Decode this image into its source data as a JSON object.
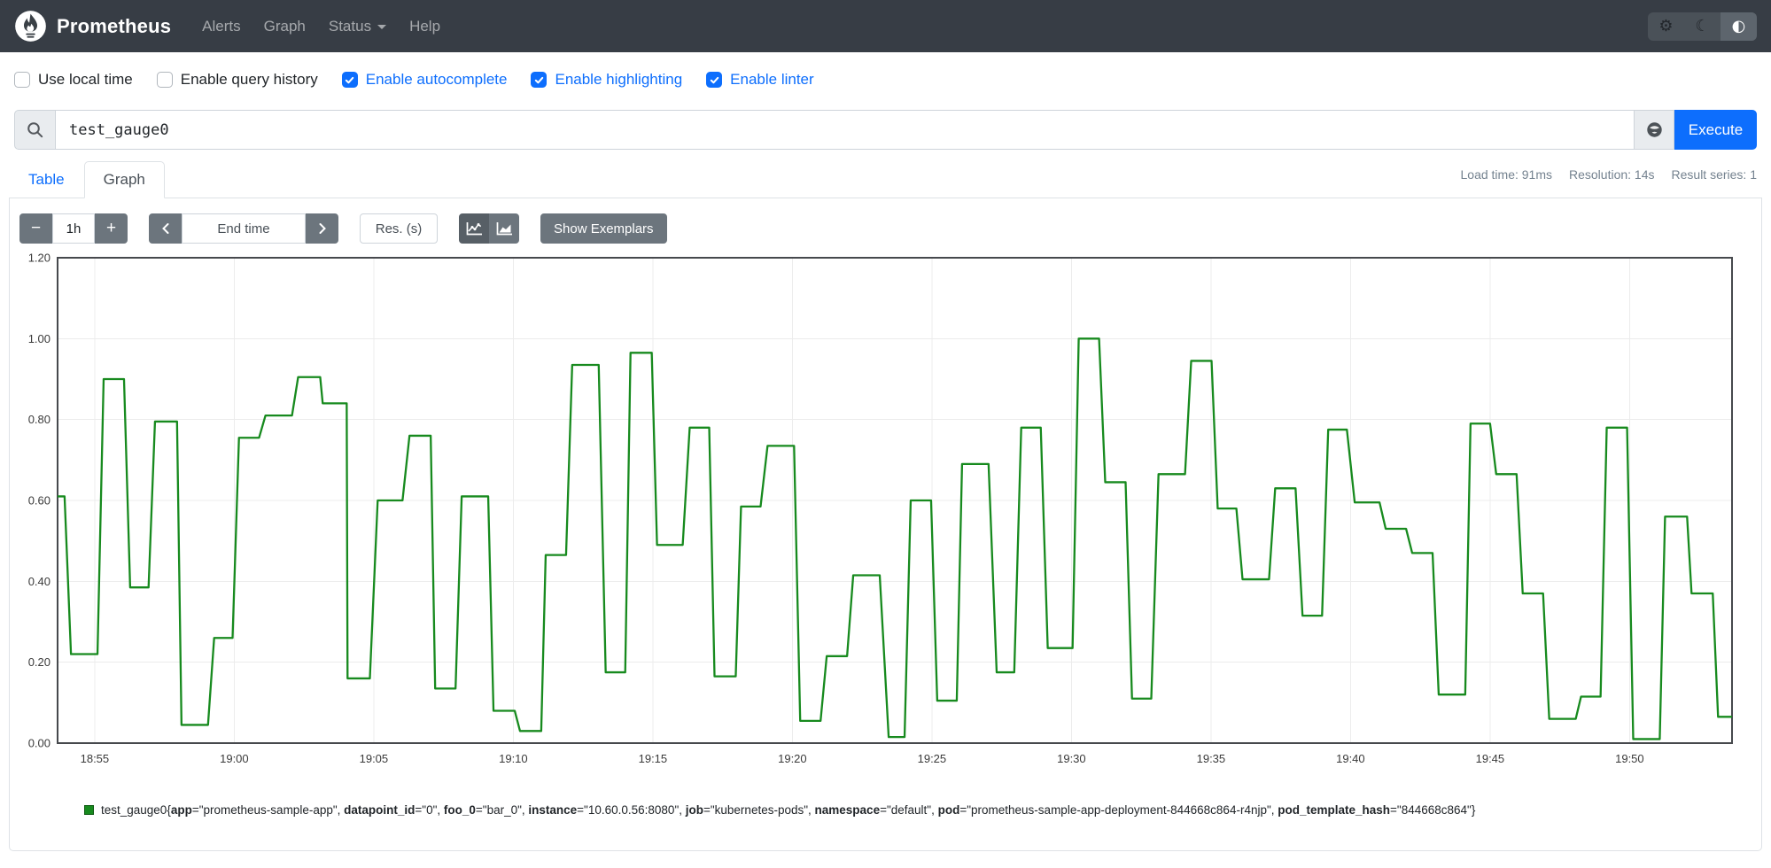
{
  "navbar": {
    "brand": "Prometheus",
    "items": [
      {
        "label": "Alerts",
        "has_caret": false
      },
      {
        "label": "Graph",
        "has_caret": false
      },
      {
        "label": "Status",
        "has_caret": true
      },
      {
        "label": "Help",
        "has_caret": false
      }
    ],
    "theme_buttons": [
      {
        "name": "settings",
        "icon": "gear-icon",
        "glyph": "⚙",
        "active": false
      },
      {
        "name": "dark-theme",
        "icon": "moon-icon",
        "glyph": "☾",
        "active": false
      },
      {
        "name": "auto-theme",
        "icon": "contrast-half-circle-icon",
        "glyph": "◐",
        "active": true
      }
    ]
  },
  "options": [
    {
      "label": "Use local time",
      "checked": false
    },
    {
      "label": "Enable query history",
      "checked": false
    },
    {
      "label": "Enable autocomplete",
      "checked": true
    },
    {
      "label": "Enable highlighting",
      "checked": true
    },
    {
      "label": "Enable linter",
      "checked": true
    }
  ],
  "query": {
    "value": "test_gauge0",
    "execute_label": "Execute",
    "search_icon": "magnifier",
    "explorer_icon": "globe"
  },
  "tabs": [
    {
      "label": "Table",
      "active": false
    },
    {
      "label": "Graph",
      "active": true
    }
  ],
  "stats": [
    {
      "label": "Load time",
      "value": "91ms"
    },
    {
      "label": "Resolution",
      "value": "14s"
    },
    {
      "label": "Result series",
      "value": "1"
    }
  ],
  "controls": {
    "range_minus": "−",
    "range_value": "1h",
    "range_plus": "+",
    "end_time_placeholder": "End time",
    "res_placeholder": "Res. (s)",
    "show_exemplars": "Show Exemplars",
    "chart_toggle_icons": [
      "line-chart-icon",
      "stacked-chart-icon"
    ]
  },
  "colors": {
    "navbar_bg": "#373d45",
    "accent_blue": "#0d6efd",
    "button_gray": "#6c757d",
    "button_gray_active": "#575f66",
    "series_green": "#178a1e",
    "grid": "#ececec",
    "plot_border": "#46494d",
    "panel_border": "#dee2e6"
  },
  "chart_data": {
    "type": "line",
    "step": true,
    "title": "",
    "xlabel": "",
    "ylabel": "",
    "grid": true,
    "legend_position": "bottom-left",
    "ylim": [
      0,
      1.2
    ],
    "y_ticks": [
      {
        "v": 0.0,
        "label": "0.00"
      },
      {
        "v": 0.2,
        "label": "0.20"
      },
      {
        "v": 0.4,
        "label": "0.40"
      },
      {
        "v": 0.6,
        "label": "0.60"
      },
      {
        "v": 0.8,
        "label": "0.80"
      },
      {
        "v": 1.0,
        "label": "1.00"
      },
      {
        "v": 1.2,
        "label": "1.20"
      }
    ],
    "x_axis": {
      "range_minutes": [
        0,
        60
      ],
      "ticks": [
        {
          "m": 1.33,
          "label": "18:55"
        },
        {
          "m": 6.33,
          "label": "19:00"
        },
        {
          "m": 11.33,
          "label": "19:05"
        },
        {
          "m": 16.33,
          "label": "19:10"
        },
        {
          "m": 21.33,
          "label": "19:15"
        },
        {
          "m": 26.33,
          "label": "19:20"
        },
        {
          "m": 31.33,
          "label": "19:25"
        },
        {
          "m": 36.33,
          "label": "19:30"
        },
        {
          "m": 41.33,
          "label": "19:35"
        },
        {
          "m": 46.33,
          "label": "19:40"
        },
        {
          "m": 51.33,
          "label": "19:45"
        },
        {
          "m": 56.33,
          "label": "19:50"
        }
      ]
    },
    "series": [
      {
        "name": "test_gauge0{app=\"prometheus-sample-app\", datapoint_id=\"0\", foo_0=\"bar_0\", instance=\"10.60.0.56:8080\", job=\"kubernetes-pods\", namespace=\"default\", pod=\"prometheus-sample-app-deployment-844668c864-r4njp\", pod_template_hash=\"844668c864\"}",
        "color": "#178a1e",
        "segments_min_start_end_value": [
          [
            0.0,
            0.25,
            0.61
          ],
          [
            0.48,
            1.43,
            0.22
          ],
          [
            1.65,
            2.38,
            0.9
          ],
          [
            2.6,
            3.26,
            0.385
          ],
          [
            3.49,
            4.28,
            0.795
          ],
          [
            4.44,
            5.39,
            0.045
          ],
          [
            5.61,
            6.27,
            0.26
          ],
          [
            6.5,
            7.22,
            0.755
          ],
          [
            7.45,
            8.4,
            0.81
          ],
          [
            8.62,
            9.41,
            0.905
          ],
          [
            9.5,
            10.36,
            0.84
          ],
          [
            10.39,
            11.19,
            0.16
          ],
          [
            11.47,
            12.36,
            0.6
          ],
          [
            12.61,
            13.37,
            0.76
          ],
          [
            13.53,
            14.26,
            0.135
          ],
          [
            14.48,
            15.43,
            0.61
          ],
          [
            15.62,
            16.38,
            0.08
          ],
          [
            16.57,
            17.33,
            0.03
          ],
          [
            17.49,
            18.22,
            0.465
          ],
          [
            18.44,
            19.39,
            0.935
          ],
          [
            19.64,
            20.34,
            0.175
          ],
          [
            20.53,
            21.29,
            0.965
          ],
          [
            21.48,
            22.4,
            0.49
          ],
          [
            22.65,
            23.35,
            0.78
          ],
          [
            23.54,
            24.3,
            0.165
          ],
          [
            24.49,
            25.19,
            0.585
          ],
          [
            25.44,
            26.39,
            0.735
          ],
          [
            26.61,
            27.34,
            0.055
          ],
          [
            27.56,
            28.29,
            0.215
          ],
          [
            28.51,
            29.46,
            0.415
          ],
          [
            29.78,
            30.35,
            0.015
          ],
          [
            30.57,
            31.3,
            0.6
          ],
          [
            31.52,
            32.22,
            0.105
          ],
          [
            32.41,
            33.36,
            0.69
          ],
          [
            33.65,
            34.28,
            0.175
          ],
          [
            34.53,
            35.23,
            0.78
          ],
          [
            35.48,
            36.37,
            0.235
          ],
          [
            36.59,
            37.32,
            1.0
          ],
          [
            37.54,
            38.27,
            0.645
          ],
          [
            38.5,
            39.19,
            0.11
          ],
          [
            39.45,
            40.4,
            0.665
          ],
          [
            40.62,
            41.35,
            0.945
          ],
          [
            41.57,
            42.24,
            0.58
          ],
          [
            42.46,
            43.41,
            0.405
          ],
          [
            43.63,
            44.36,
            0.63
          ],
          [
            44.61,
            45.31,
            0.315
          ],
          [
            45.53,
            46.2,
            0.775
          ],
          [
            46.48,
            47.37,
            0.595
          ],
          [
            47.59,
            48.32,
            0.53
          ],
          [
            48.54,
            49.27,
            0.47
          ],
          [
            49.49,
            50.44,
            0.12
          ],
          [
            50.63,
            51.33,
            0.79
          ],
          [
            51.55,
            52.28,
            0.665
          ],
          [
            52.5,
            53.23,
            0.37
          ],
          [
            53.45,
            54.4,
            0.06
          ],
          [
            54.59,
            55.29,
            0.115
          ],
          [
            55.51,
            56.24,
            0.78
          ],
          [
            56.46,
            57.41,
            0.01
          ],
          [
            57.6,
            58.39,
            0.56
          ],
          [
            58.55,
            59.31,
            0.37
          ],
          [
            59.5,
            60.0,
            0.065
          ]
        ]
      }
    ]
  },
  "legend": {
    "metric": "test_gauge0",
    "labels": [
      {
        "key": "app",
        "value": "prometheus-sample-app"
      },
      {
        "key": "datapoint_id",
        "value": "0"
      },
      {
        "key": "foo_0",
        "value": "bar_0"
      },
      {
        "key": "instance",
        "value": "10.60.0.56:8080"
      },
      {
        "key": "job",
        "value": "kubernetes-pods"
      },
      {
        "key": "namespace",
        "value": "default"
      },
      {
        "key": "pod",
        "value": "prometheus-sample-app-deployment-844668c864-r4njp"
      },
      {
        "key": "pod_template_hash",
        "value": "844668c864"
      }
    ]
  }
}
